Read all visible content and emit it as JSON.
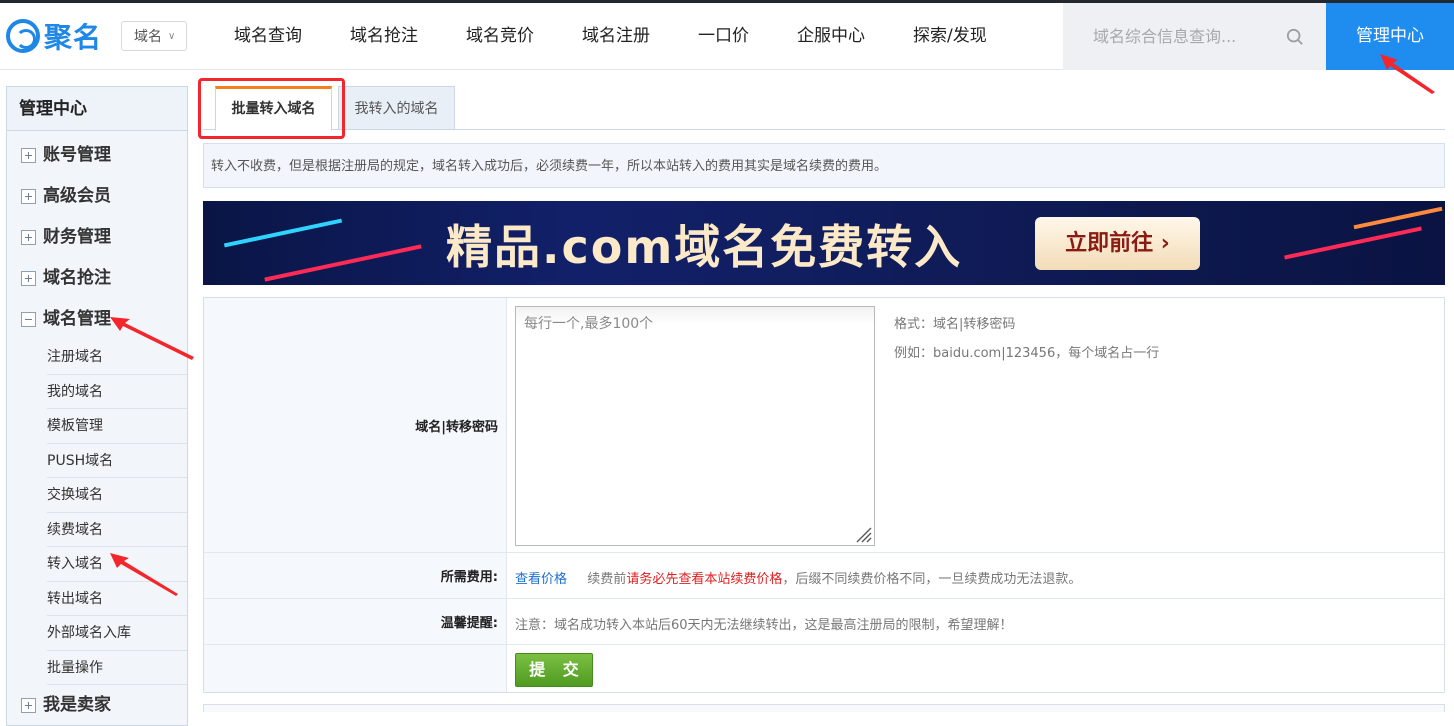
{
  "header": {
    "logo_text": "聚名",
    "domain_select": "域名",
    "nav": [
      "域名查询",
      "域名抢注",
      "域名竞价",
      "域名注册",
      "一口价",
      "企服中心",
      "探索/发现"
    ],
    "search_placeholder": "域名综合信息查询...",
    "admin_button": "管理中心"
  },
  "sidebar": {
    "title": "管理中心",
    "groups": [
      "账号管理",
      "高级会员",
      "财务管理",
      "域名抢注",
      "域名管理",
      "我是卖家"
    ],
    "domain_mgmt_items": [
      "注册域名",
      "我的域名",
      "模板管理",
      "PUSH域名",
      "交换域名",
      "续费域名",
      "转入域名",
      "转出域名",
      "外部域名入库",
      "批量操作"
    ]
  },
  "tabs": {
    "active": "批量转入域名",
    "other": "我转入的域名"
  },
  "notice": "转入不收费，但是根据注册局的规定，域名转入成功后，必须续费一年，所以本站转入的费用其实是域名续费的费用。",
  "banner": {
    "title": "精品.com域名免费转入",
    "button": "立即前往 ›"
  },
  "form": {
    "domain_label": "域名|转移密码",
    "textarea_placeholder": "每行一个,最多100个",
    "format_hint": "格式：域名|转移密码",
    "example_hint": "例如：baidu.com|123456，每个域名占一行",
    "fee_label": "所需费用:",
    "fee_link": "查看价格",
    "fee_text_prefix": "续费前",
    "fee_text_red": "请务必先查看本站续费价格",
    "fee_text_suffix": "，后缀不同续费价格不同，一旦续费成功无法退款。",
    "reminder_label": "温馨提醒:",
    "reminder_text": "注意：域名成功转入本站后60天内无法继续转出，这是最高注册局的限制，希望理解！",
    "submit": "提 交"
  },
  "colors": {
    "brand_blue": "#1f8cf0",
    "highlight_red": "#f3262c",
    "tab_orange": "#f57e1e",
    "submit_green": "#5aa52a"
  }
}
